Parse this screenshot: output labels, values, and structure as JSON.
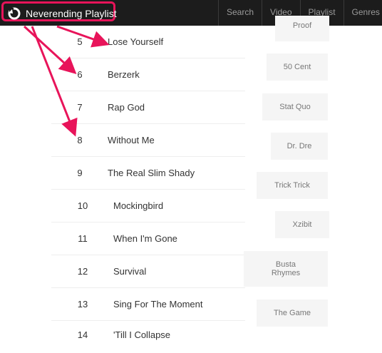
{
  "header": {
    "app_title": "Neverending Playlist",
    "logo_icon": "circle-arrow-icon",
    "nav": [
      "Search",
      "Video",
      "Playlist",
      "Genres"
    ]
  },
  "tracks": [
    {
      "num": "5",
      "title": "Lose Yourself"
    },
    {
      "num": "6",
      "title": "Berzerk"
    },
    {
      "num": "7",
      "title": "Rap God"
    },
    {
      "num": "8",
      "title": "Without Me"
    },
    {
      "num": "9",
      "title": "The Real Slim Shady"
    },
    {
      "num": "10",
      "title": "Mockingbird"
    },
    {
      "num": "11",
      "title": "When I'm Gone"
    },
    {
      "num": "12",
      "title": "Survival"
    },
    {
      "num": "13",
      "title": "Sing For The Moment"
    },
    {
      "num": "14",
      "title": "'Till I Collapse"
    }
  ],
  "artists": [
    "Proof",
    "50 Cent",
    "Stat Quo",
    "Dr. Dre",
    "Trick Trick",
    "Xzibit",
    "Busta Rhymes",
    "The Game"
  ],
  "colors": {
    "navbar": "#1c1c1c",
    "annotation": "#e8145a",
    "artist_bg": "#f5f5f5"
  }
}
